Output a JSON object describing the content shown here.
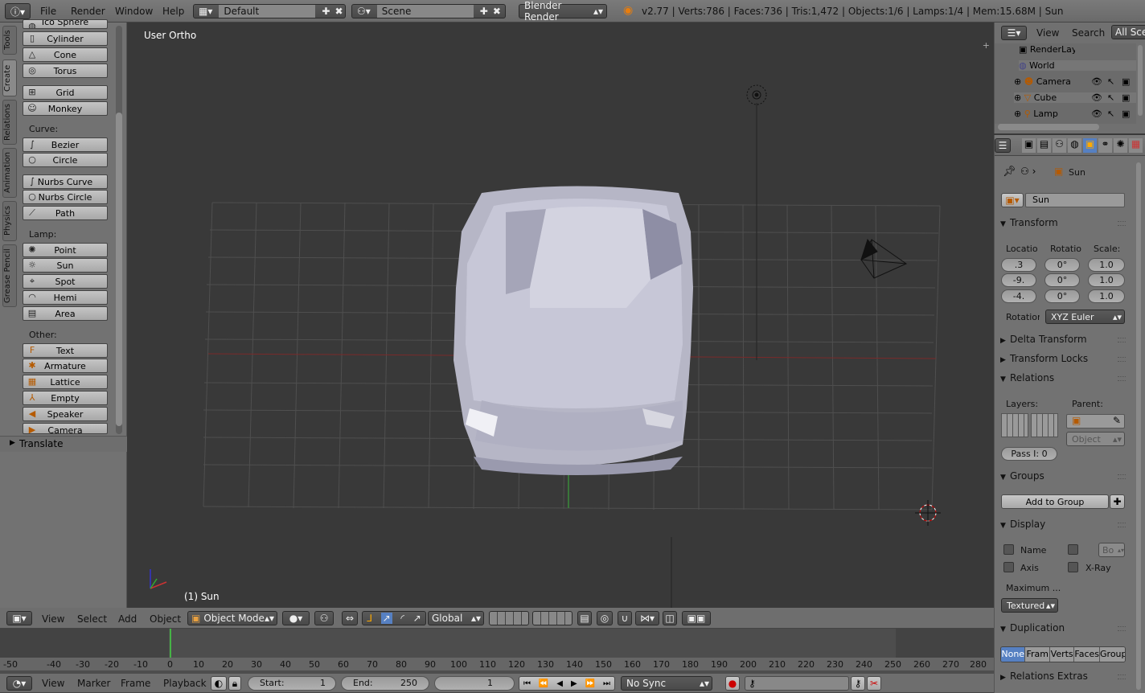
{
  "topbar": {
    "menus": [
      "File",
      "Render",
      "Window",
      "Help"
    ],
    "layout": "Default",
    "scene": "Scene",
    "engine": "Blender Render",
    "stats": "v2.77 | Verts:786 | Faces:736 | Tris:1,472 | Objects:1/6 | Lamps:1/4 | Mem:15.68M | Sun"
  },
  "viewport": {
    "view_label": "User Ortho",
    "object_label": "(1) Sun"
  },
  "tools": {
    "vtabs": [
      "Tools",
      "Create",
      "Relations",
      "Animation",
      "Physics",
      "Grease Pencil"
    ],
    "mesh": [
      "Ico Sphere",
      "Cylinder",
      "Cone",
      "Torus",
      "Grid",
      "Monkey"
    ],
    "curve_label": "Curve:",
    "curve": [
      "Bezier",
      "Circle",
      "Nurbs Curve",
      "Nurbs Circle",
      "Path"
    ],
    "lamp_label": "Lamp:",
    "lamp": [
      "Point",
      "Sun",
      "Spot",
      "Hemi",
      "Area"
    ],
    "other_label": "Other:",
    "other": [
      "Text",
      "Armature",
      "Lattice",
      "Empty",
      "Speaker",
      "Camera"
    ],
    "translate": "Translate"
  },
  "outliner": {
    "menus": [
      "View",
      "Search",
      "All Scenes"
    ],
    "items": [
      "RenderLayers",
      "World",
      "Camera",
      "Cube",
      "Lamp"
    ]
  },
  "properties": {
    "object_name": "Sun",
    "name_field": "Sun",
    "transform": "Transform",
    "loc_label": "Location",
    "rot_label": "Rotation",
    "scale_label": "Scale:",
    "loc": [
      ".3",
      "-9.",
      "-4."
    ],
    "rot": [
      "0°",
      "0°",
      "0°"
    ],
    "scale": [
      "1.0",
      "1.0",
      "1.0"
    ],
    "rotmode_label": "Rotation",
    "rotmode": "XYZ Euler",
    "delta": "Delta Transform",
    "locks": "Transform Locks",
    "relations": "Relations",
    "layers_label": "Layers:",
    "parent_label": "Parent:",
    "parent_type": "Object",
    "pass_index": "Pass I: 0",
    "groups": "Groups",
    "add_group": "Add to Group",
    "display": "Display",
    "name_cb": "Name",
    "axis_cb": "Axis",
    "bounds": "Bo",
    "xray": "X-Ray",
    "max_draw": "Maximum ...",
    "draw_type": "Textured",
    "duplication": "Duplication",
    "dup_modes": [
      "None",
      "Fram",
      "Verts",
      "Faces",
      "Group"
    ],
    "rel_extras": "Relations Extras"
  },
  "view3d_header": {
    "menus": [
      "View",
      "Select",
      "Add",
      "Object"
    ],
    "mode": "Object Mode",
    "orientation": "Global"
  },
  "timeline": {
    "ticks": [
      "-50",
      "-40",
      "-30",
      "-20",
      "-10",
      "0",
      "10",
      "20",
      "30",
      "40",
      "50",
      "60",
      "70",
      "80",
      "90",
      "100",
      "110",
      "120",
      "130",
      "140",
      "150",
      "160",
      "170",
      "180",
      "190",
      "200",
      "210",
      "220",
      "230",
      "240",
      "250",
      "260",
      "270",
      "280"
    ],
    "menus": [
      "View",
      "Marker",
      "Frame",
      "Playback"
    ],
    "start": "Start:",
    "start_val": "1",
    "end": "End:",
    "end_val": "250",
    "current": "1",
    "sync": "No Sync"
  }
}
